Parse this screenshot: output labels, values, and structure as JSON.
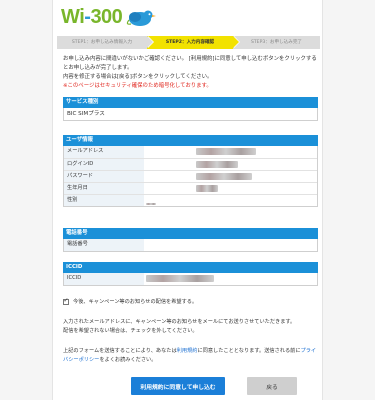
{
  "logo": {
    "text_a": "Wi",
    "text_b": "-",
    "text_c": "300"
  },
  "steps": [
    {
      "label": "STEP1：お申し込み情報入力"
    },
    {
      "label": "STEP2：入力内容確認"
    },
    {
      "label": "STEP3：お申し込み完了"
    }
  ],
  "intro": {
    "line1": "お申し込み内容に間違いがないかご確認ください。 [利用規約]に同意して申し込むボタンをクリックするとお申し込みが完了します。",
    "line2": "内容を修正する場合は[戻る]ボタンをクリックしてください。",
    "warning": "※このページはセキュリティ確保のため暗号化しております。"
  },
  "service": {
    "title": "サービス種別",
    "value": "BIC SIMプラス"
  },
  "user": {
    "title": "ユーザ情報",
    "rows": [
      {
        "label": "メールアドレス"
      },
      {
        "label": "ログインID"
      },
      {
        "label": "パスワード"
      },
      {
        "label": "生年月日"
      },
      {
        "label": "性別"
      }
    ]
  },
  "phone": {
    "title": "電話番号",
    "label": "電話番号"
  },
  "iccid": {
    "title": "ICCID",
    "label": "ICCID"
  },
  "optin": {
    "label": "今後、キャンペーン等のお知らせの配信を希望する。"
  },
  "note1": {
    "line1": "入力されたメールアドレスに、キャンペーン等のお知らせをメールにてお送りさせていただきます。",
    "line2": "配信を希望されない場合は、チェックを外してください。"
  },
  "note2": {
    "pre": "上記のフォームを送信することにより、あなたは",
    "link1": "利用規約",
    "mid": "に同意したこととなります。送信される前に",
    "link2": "プライバシーポリシー",
    "post": "をよくお読みください。"
  },
  "buttons": {
    "agree": "利用規約に同意して申し込む",
    "back": "戻る"
  },
  "colors": {
    "accent": "#1b90d8",
    "step_active": "#f2e200",
    "warning": "#e0241c"
  }
}
